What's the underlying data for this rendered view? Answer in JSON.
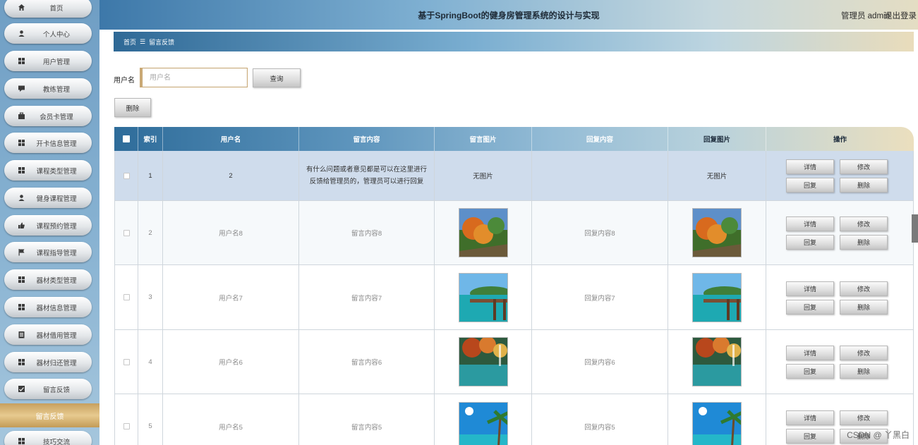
{
  "header": {
    "title": "基于SpringBoot的健身房管理系统的设计与实现",
    "user": "管理员 admin",
    "logout": "退出登录"
  },
  "sidebar": {
    "items": [
      {
        "label": "首页",
        "icon": "home-icon"
      },
      {
        "label": "个人中心",
        "icon": "person-icon"
      },
      {
        "label": "用户管理",
        "icon": "grid-icon"
      },
      {
        "label": "教练管理",
        "icon": "chat-icon"
      },
      {
        "label": "会员卡管理",
        "icon": "card-icon"
      },
      {
        "label": "开卡信息管理",
        "icon": "grid-icon"
      },
      {
        "label": "课程类型管理",
        "icon": "grid-icon"
      },
      {
        "label": "健身课程管理",
        "icon": "person-icon"
      },
      {
        "label": "课程预约管理",
        "icon": "thumb-icon"
      },
      {
        "label": "课程指导管理",
        "icon": "flag-icon"
      },
      {
        "label": "器材类型管理",
        "icon": "grid-icon"
      },
      {
        "label": "器材信息管理",
        "icon": "grid-icon"
      },
      {
        "label": "器材借用管理",
        "icon": "doc-icon"
      },
      {
        "label": "器材归还管理",
        "icon": "grid-icon"
      },
      {
        "label": "留言反馈",
        "icon": "message-icon"
      }
    ],
    "active": "留言反馈",
    "next_item": "技巧交流"
  },
  "breadcrumb": {
    "home": "首页",
    "current": "留言反馈"
  },
  "search": {
    "label": "用户名",
    "placeholder": "用户名",
    "button": "查询"
  },
  "toolbar": {
    "delete": "删除"
  },
  "table": {
    "headers": [
      "索引",
      "用户名",
      "留言内容",
      "留言图片",
      "回复内容",
      "回复图片",
      "操作"
    ],
    "rows": [
      {
        "index": "1",
        "username": "2",
        "message": "有什么问题或者意见都是可以在这里进行反馈给管理员的，管理员可以进行回复",
        "msg_image": "无图片",
        "reply": "",
        "reply_image": "无图片",
        "selected": true
      },
      {
        "index": "2",
        "username": "用户名8",
        "message": "留言内容8",
        "msg_image": "autumn",
        "reply": "回复内容8",
        "reply_image": "autumn"
      },
      {
        "index": "3",
        "username": "用户名7",
        "message": "留言内容7",
        "msg_image": "pier",
        "reply": "回复内容7",
        "reply_image": "pier"
      },
      {
        "index": "4",
        "username": "用户名6",
        "message": "留言内容6",
        "msg_image": "lake",
        "reply": "回复内容6",
        "reply_image": "lake"
      },
      {
        "index": "5",
        "username": "用户名5",
        "message": "留言内容5",
        "msg_image": "beach",
        "reply": "回复内容5",
        "reply_image": "beach"
      }
    ],
    "actions": {
      "detail": "详情",
      "edit": "修改",
      "reply": "回复",
      "delete": "删除"
    }
  },
  "watermark": "CSDN @ 丫黑白",
  "colors": {
    "accent_blue": "#2e6c9a",
    "accent_gold": "#c7a05f",
    "row_selected": "#cfdcec"
  }
}
